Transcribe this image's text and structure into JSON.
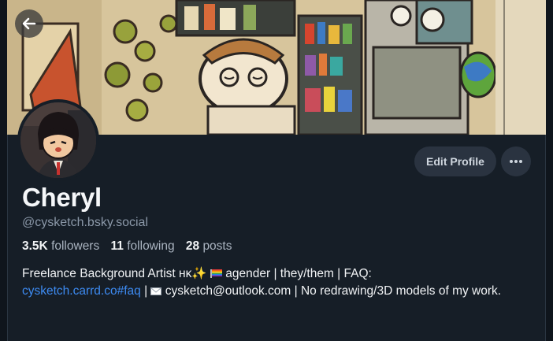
{
  "profile": {
    "display_name": "Cheryl",
    "handle": "@cysketch.bsky.social",
    "edit_label": "Edit Profile",
    "more_label": "···"
  },
  "stats": {
    "followers_count": "3.5K",
    "followers_label": "followers",
    "following_count": "11",
    "following_label": "following",
    "posts_count": "28",
    "posts_label": "posts"
  },
  "bio": {
    "part1": "Freelance Background Artist ʜᴋ",
    "part2": "agender | they/them | FAQ:",
    "link_text": "cysketch.carrd.co#faq",
    "sep": " | ",
    "email_text": "cysketch@outlook.com",
    "part3": "| No redrawing/3D models of my work."
  },
  "icons": {
    "back": "arrow-left-icon",
    "more": "ellipsis-icon",
    "sparkle": "sparkles-icon",
    "flag": "rainbow-flag-icon",
    "envelope": "envelope-icon"
  },
  "colors": {
    "background": "#161e27",
    "link": "#3d8bf2",
    "muted": "#8b98a8",
    "button_bg": "#2a3340"
  }
}
